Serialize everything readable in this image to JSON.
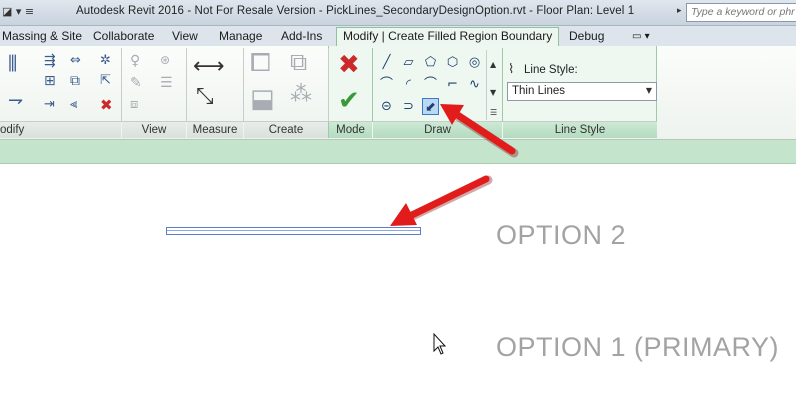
{
  "titlebar": {
    "quick_access": "◪ ▾  ≡",
    "title": "Autodesk Revit 2016 - Not For Resale Version -    PickLines_SecondaryDesignOption.rvt - Floor Plan: Level 1",
    "search_arrow": "▸",
    "search_placeholder": "Type a keyword or phr"
  },
  "tabs": [
    {
      "label": "Massing & Site"
    },
    {
      "label": "Collaborate"
    },
    {
      "label": "View"
    },
    {
      "label": "Manage"
    },
    {
      "label": "Add-Ins"
    },
    {
      "label": "Modify | Create Filled Region Boundary"
    },
    {
      "label": "Debug"
    },
    {
      "label": "▭ ▾"
    }
  ],
  "panels": {
    "modify": "odify",
    "view": "View",
    "measure": "Measure",
    "create": "Create",
    "mode": "Mode",
    "draw": "Draw",
    "line_style": "Line Style"
  },
  "line_style": {
    "label": "Line Style:",
    "value": "Thin Lines"
  },
  "drawing": {
    "option2": "OPTION 2",
    "option1": "OPTION 1 (PRIMARY)"
  },
  "colors": {
    "annotation_arrow": "#e21b1b",
    "active_tab_border": "#8fc39a",
    "options_bar": "#c5e4cc"
  }
}
